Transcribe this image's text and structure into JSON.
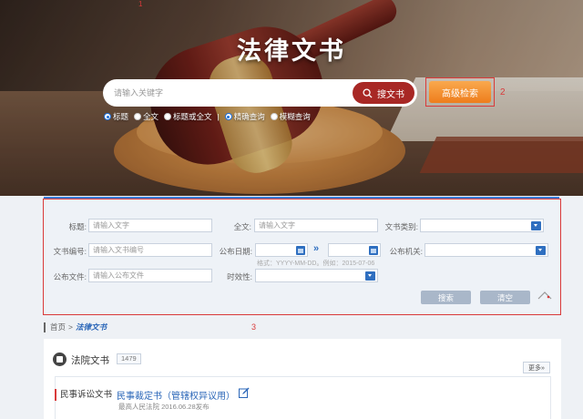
{
  "markers": {
    "m1": "1",
    "m2": "2",
    "m3": "3"
  },
  "hero": {
    "title": "法律文书",
    "search_placeholder": "请输入关键字",
    "search_button": "搜文书",
    "advanced_button": "高级检索",
    "modes": [
      {
        "label": "标题",
        "checked": true
      },
      {
        "label": "全文",
        "checked": false
      },
      {
        "label": "标题或全文",
        "checked": false
      },
      {
        "label": "精确查询",
        "checked": true
      },
      {
        "label": "模糊查询",
        "checked": false
      }
    ]
  },
  "panel": {
    "title_label": "标题:",
    "title_placeholder": "请输入文字",
    "fulltext_label": "全文:",
    "fulltext_placeholder": "请输入文字",
    "doctype_label": "文书类别:",
    "docno_label": "文书编号:",
    "docno_placeholder": "请输入文书编号",
    "pubdate_label": "公布日期:",
    "date_hint": "格式：YYYY-MM-DD。例如：2015-07-06",
    "pubagency_label": "公布机关:",
    "pubfile_label": "公布文件:",
    "pubfile_placeholder": "请输入公布文件",
    "validity_label": "时效性:",
    "search_button": "搜索",
    "clear_button": "清空"
  },
  "breadcrumb": {
    "home": "首页",
    "separator": ">",
    "current": "法律文书"
  },
  "results": {
    "title": "法院文书",
    "count": "1479",
    "more_button": "更多»",
    "items": [
      {
        "category": "民事诉讼文书",
        "title": "民事裁定书（管辖权异议用）",
        "meta": "最高人民法院  2016.06.28发布"
      }
    ]
  },
  "colors": {
    "accent_red": "#a82825",
    "accent_orange": "#ee7d1c",
    "link_blue": "#2a66b8",
    "annotation_red": "#d93a3a"
  }
}
